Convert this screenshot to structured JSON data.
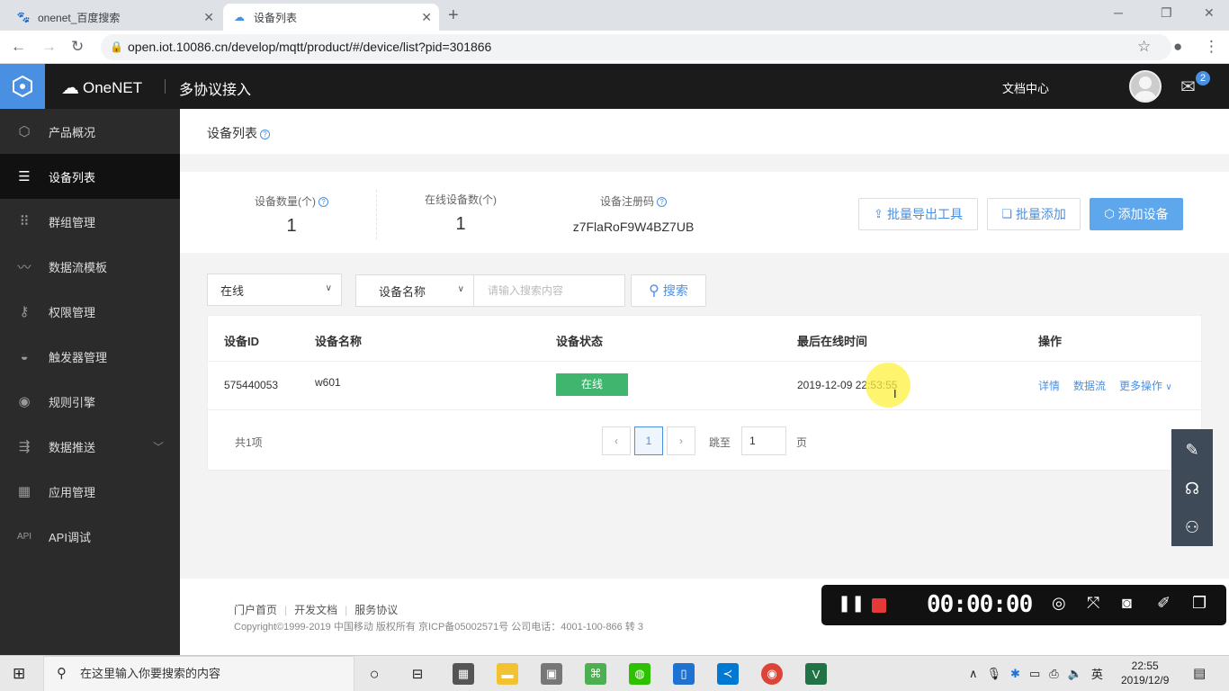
{
  "browser": {
    "tabs": [
      {
        "title": "onenet_百度搜索",
        "icon": "paw-icon"
      },
      {
        "title": "设备列表",
        "icon": "cloud-icon"
      }
    ],
    "url": "open.iot.10086.cn/develop/mqtt/product/#/device/list?pid=301866"
  },
  "header": {
    "brand": "OneNET",
    "product": "多协议接入",
    "doc_center": "文档中心",
    "mail_count": "2"
  },
  "sidebar": {
    "items": [
      {
        "label": "产品概况",
        "icon": "cube-icon"
      },
      {
        "label": "设备列表",
        "icon": "list-icon"
      },
      {
        "label": "群组管理",
        "icon": "grid-icon"
      },
      {
        "label": "数据流模板",
        "icon": "chart-line-icon"
      },
      {
        "label": "权限管理",
        "icon": "key-icon"
      },
      {
        "label": "触发器管理",
        "icon": "trigger-icon"
      },
      {
        "label": "规则引擎",
        "icon": "rule-icon"
      },
      {
        "label": "数据推送",
        "icon": "push-icon"
      },
      {
        "label": "应用管理",
        "icon": "apps-icon"
      },
      {
        "label": "API调试",
        "icon": "api-icon"
      }
    ]
  },
  "page": {
    "title": "设备列表",
    "stats": {
      "device_count_label": "设备数量(个)",
      "device_count": "1",
      "online_count_label": "在线设备数(个)",
      "online_count": "1",
      "reg_code_label": "设备注册码",
      "reg_code": "z7FlaRoF9W4BZ7UB"
    },
    "buttons": {
      "export": "批量导出工具",
      "batch_add": "批量添加",
      "add_device": "添加设备"
    },
    "filter": {
      "status_value": "在线",
      "field_value": "设备名称",
      "search_placeholder": "请输入搜索内容",
      "search_label": "搜索"
    },
    "table": {
      "headers": [
        "设备ID",
        "设备名称",
        "设备状态",
        "最后在线时间",
        "操作"
      ],
      "rows": [
        {
          "id": "575440053",
          "name": "w601",
          "status": "在线",
          "last_online": "2019-12-09 22:53:55",
          "ops": [
            "详情",
            "数据流",
            "更多操作"
          ]
        }
      ]
    },
    "pagination": {
      "total": "共1项",
      "current": "1",
      "jump_label": "跳至",
      "jump_value": "1",
      "page_suffix": "页",
      "prev": "‹",
      "next": "›"
    }
  },
  "footer": {
    "links": [
      "门户首页",
      "开发文档",
      "服务协议"
    ],
    "copyright": "Copyright©1999-2019 中国移动 版权所有 京ICP备05002571号 公司电话：4001-100-866 转 3"
  },
  "recorder": {
    "time": "00:00:00"
  },
  "taskbar": {
    "search_placeholder": "在这里输入你要搜索的内容",
    "ime": "英",
    "time": "22:55",
    "date": "2019/12/9"
  },
  "colors": {
    "accent": "#4a90e2",
    "online": "#3fb56d",
    "sidebar_bg": "#2b2b2b",
    "header_bg": "#1b1b1b"
  }
}
